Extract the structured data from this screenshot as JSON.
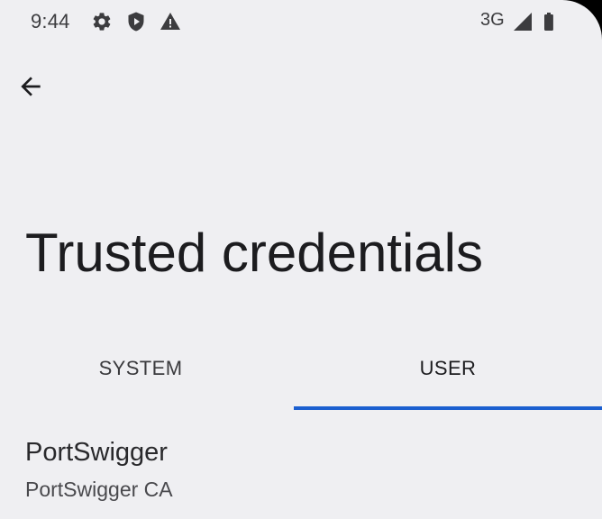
{
  "status_bar": {
    "time": "9:44",
    "icons_left": [
      "settings-gear-icon",
      "shield-play-icon",
      "warning-triangle-icon"
    ],
    "network": "3G",
    "icons_right": [
      "cellular-signal-icon",
      "battery-icon"
    ]
  },
  "header": {
    "back_icon": "arrow-back-icon",
    "title": "Trusted credentials"
  },
  "tabs": [
    {
      "label": "SYSTEM",
      "active": false
    },
    {
      "label": "USER",
      "active": true
    }
  ],
  "credentials": [
    {
      "title": "PortSwigger",
      "subtitle": "PortSwigger CA"
    }
  ],
  "colors": {
    "background": "#efeff2",
    "accent": "#1b5fd0",
    "text_primary": "#1c1c1f",
    "text_secondary": "#49494d"
  }
}
